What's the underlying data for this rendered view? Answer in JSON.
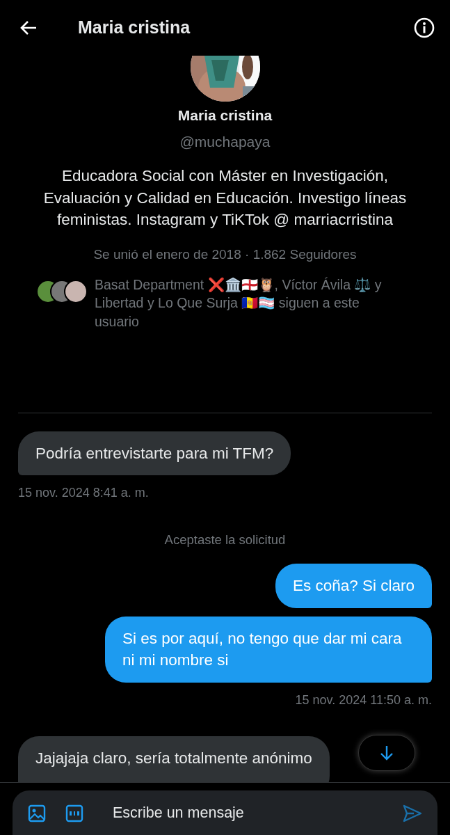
{
  "header": {
    "title": "Maria cristina"
  },
  "profile": {
    "name": "Maria cristina",
    "handle": "@muchapaya",
    "bio": "Educadora Social con Máster en Investigación, Evaluación y Calidad en Educación. Investigo líneas feministas. Instagram y TiKTok @ marriacrristina",
    "joined": "Se unió el enero de 2018 · 1.862 Seguidores",
    "followed_by": "Basat Department ❌🏛️🏴󠁧󠁢󠁥󠁮󠁧󠁿🦉, Víctor Ávila ⚖️ y Libertad y Lo Que Surja 🇦🇩🏳️‍⚧️ siguen a este usuario"
  },
  "messages": [
    {
      "kind": "received",
      "text": "Podría entrevistarte para mi TFM?"
    },
    {
      "kind": "time-left",
      "text": "15 nov. 2024 8:41 a. m."
    },
    {
      "kind": "system",
      "text": "Aceptaste la solicitud"
    },
    {
      "kind": "sent",
      "text": "Es coña? Si claro"
    },
    {
      "kind": "sent",
      "text": "Si es por aquí, no tengo que dar mi cara ni mi nombre si"
    },
    {
      "kind": "time-right",
      "text": "15 nov. 2024 11:50 a. m."
    },
    {
      "kind": "received",
      "text": "Jajajaja claro, sería totalmente anónimo"
    }
  ],
  "composer": {
    "placeholder": "Escribe un mensaje"
  }
}
